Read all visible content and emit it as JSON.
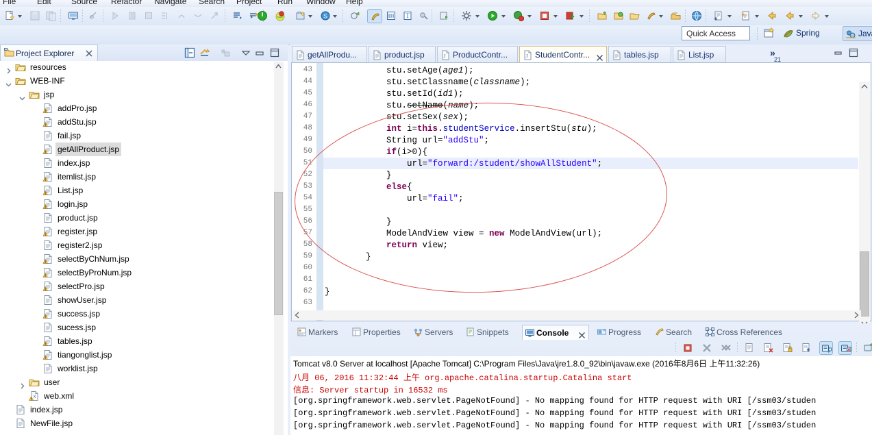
{
  "menu": {
    "items": [
      "File",
      "Edit",
      "Source",
      "Refactor",
      "Navigate",
      "Search",
      "Project",
      "Run",
      "Window",
      "Help"
    ]
  },
  "quick_access": {
    "placeholder": "Quick Access",
    "value": ""
  },
  "perspectives": [
    {
      "label": "Spring",
      "active": false
    },
    {
      "label": "Java EE",
      "active": true
    }
  ],
  "project_explorer": {
    "title": "Project Explorer",
    "tree": [
      {
        "label": "resources",
        "depth": 2,
        "type": "folder",
        "twisty": "collapsed",
        "selected": false
      },
      {
        "label": "WEB-INF",
        "depth": 2,
        "type": "folder",
        "twisty": "expanded",
        "selected": false
      },
      {
        "label": "jsp",
        "depth": 3,
        "type": "folder",
        "twisty": "expanded",
        "selected": false
      },
      {
        "label": "addPro.jsp",
        "depth": 4,
        "type": "jsp-warn",
        "twisty": "none",
        "selected": false
      },
      {
        "label": "addStu.jsp",
        "depth": 4,
        "type": "jsp-warn",
        "twisty": "none",
        "selected": false
      },
      {
        "label": "fail.jsp",
        "depth": 4,
        "type": "jsp",
        "twisty": "none",
        "selected": false
      },
      {
        "label": "getAllProduct.jsp",
        "depth": 4,
        "type": "jsp-warn",
        "twisty": "none",
        "selected": true
      },
      {
        "label": "index.jsp",
        "depth": 4,
        "type": "jsp",
        "twisty": "none",
        "selected": false
      },
      {
        "label": "itemlist.jsp",
        "depth": 4,
        "type": "jsp-warn",
        "twisty": "none",
        "selected": false
      },
      {
        "label": "List.jsp",
        "depth": 4,
        "type": "jsp-warn",
        "twisty": "none",
        "selected": false
      },
      {
        "label": "login.jsp",
        "depth": 4,
        "type": "jsp-warn",
        "twisty": "none",
        "selected": false
      },
      {
        "label": "product.jsp",
        "depth": 4,
        "type": "jsp",
        "twisty": "none",
        "selected": false
      },
      {
        "label": "register.jsp",
        "depth": 4,
        "type": "jsp-warn",
        "twisty": "none",
        "selected": false
      },
      {
        "label": "register2.jsp",
        "depth": 4,
        "type": "jsp",
        "twisty": "none",
        "selected": false
      },
      {
        "label": "selectByChNum.jsp",
        "depth": 4,
        "type": "jsp-warn",
        "twisty": "none",
        "selected": false
      },
      {
        "label": "selectByProNum.jsp",
        "depth": 4,
        "type": "jsp-warn",
        "twisty": "none",
        "selected": false
      },
      {
        "label": "selectPro.jsp",
        "depth": 4,
        "type": "jsp-warn",
        "twisty": "none",
        "selected": false
      },
      {
        "label": "showUser.jsp",
        "depth": 4,
        "type": "jsp",
        "twisty": "none",
        "selected": false
      },
      {
        "label": "success.jsp",
        "depth": 4,
        "type": "jsp-warn",
        "twisty": "none",
        "selected": false
      },
      {
        "label": "sucess.jsp",
        "depth": 4,
        "type": "jsp",
        "twisty": "none",
        "selected": false
      },
      {
        "label": "tables.jsp",
        "depth": 4,
        "type": "jsp-warn",
        "twisty": "none",
        "selected": false
      },
      {
        "label": "tiangonglist.jsp",
        "depth": 4,
        "type": "jsp-warn",
        "twisty": "none",
        "selected": false
      },
      {
        "label": "worklist.jsp",
        "depth": 4,
        "type": "jsp",
        "twisty": "none",
        "selected": false
      },
      {
        "label": "user",
        "depth": 3,
        "type": "folder",
        "twisty": "collapsed",
        "selected": false
      },
      {
        "label": "web.xml",
        "depth": 3,
        "type": "xml-warn",
        "twisty": "none",
        "selected": false
      },
      {
        "label": "index.jsp",
        "depth": 2,
        "type": "jsp",
        "twisty": "none",
        "selected": false
      },
      {
        "label": "NewFile.jsp",
        "depth": 2,
        "type": "jsp",
        "twisty": "none",
        "selected": false
      }
    ]
  },
  "editor": {
    "tabs": [
      {
        "label": "getAllProdu...",
        "type": "jsp",
        "active": false,
        "closable": false
      },
      {
        "label": "product.jsp",
        "type": "jsp",
        "active": false,
        "closable": false
      },
      {
        "label": "ProductContr...",
        "type": "java",
        "active": false,
        "closable": false
      },
      {
        "label": "StudentContr...",
        "type": "java",
        "active": true,
        "closable": true
      },
      {
        "label": "tables.jsp",
        "type": "jsp",
        "active": false,
        "closable": false
      },
      {
        "label": "List.jsp",
        "type": "jsp",
        "active": false,
        "closable": false
      }
    ],
    "overflow_count": "21",
    "overflow_symbol": "»",
    "first_line_number": 43,
    "highlighted_line": 51,
    "lines": [
      {
        "n": 43,
        "html": "            stu.setAge(<i class=\"ital\">age1</i>);"
      },
      {
        "n": 44,
        "html": "            stu.setClassname(<i class=\"ital\">classname</i>);"
      },
      {
        "n": 45,
        "html": "            stu.setId(<i class=\"ital\">id1</i>);"
      },
      {
        "n": 46,
        "html": "            stu.<span class=\"deprec\">setName</span>(<i class=\"ital\">name</i>);"
      },
      {
        "n": 47,
        "html": "            stu.setSex(<i class=\"ital\">sex</i>);"
      },
      {
        "n": 48,
        "html": "            <b class=\"kw\">int</b> i=<b class=\"kw\">this</b>.<span class=\"fld\">studentService</span>.insertStu(<i class=\"ital\">stu</i>);"
      },
      {
        "n": 49,
        "html": "            String url=<span class=\"str\">\"addStu\"</span>;"
      },
      {
        "n": 50,
        "html": "            <b class=\"kw\">if</b>(i&gt;0){"
      },
      {
        "n": 51,
        "html": "                url=<span class=\"str\">\"forward:/student/showAllStudent\"</span>;"
      },
      {
        "n": 52,
        "html": "            }"
      },
      {
        "n": 53,
        "html": "            <b class=\"kw\">else</b>{"
      },
      {
        "n": 54,
        "html": "                url=<span class=\"str\">\"fail\"</span>;"
      },
      {
        "n": 55,
        "html": ""
      },
      {
        "n": 56,
        "html": "            }"
      },
      {
        "n": 57,
        "html": "            ModelAndView view = <b class=\"kw\">new</b> ModelAndView(url);"
      },
      {
        "n": 58,
        "html": "            <b class=\"kw\">return</b> view;"
      },
      {
        "n": 59,
        "html": "        }"
      },
      {
        "n": 60,
        "html": ""
      },
      {
        "n": 61,
        "html": ""
      },
      {
        "n": 62,
        "html": "}"
      },
      {
        "n": 63,
        "html": ""
      }
    ],
    "annotation": {
      "shape": "ellipse",
      "color": "#d9534f"
    }
  },
  "console_panel": {
    "tabs": [
      {
        "label": "Markers",
        "active": false,
        "closable": false
      },
      {
        "label": "Properties",
        "active": false,
        "closable": false
      },
      {
        "label": "Servers",
        "active": false,
        "closable": false
      },
      {
        "label": "Snippets",
        "active": false,
        "closable": false
      },
      {
        "label": "Console",
        "active": true,
        "closable": true
      },
      {
        "label": "Progress",
        "active": false,
        "closable": false
      },
      {
        "label": "Search",
        "active": false,
        "closable": false
      },
      {
        "label": "Cross References",
        "active": false,
        "closable": false
      }
    ],
    "header": "Tomcat v8.0 Server at localhost [Apache Tomcat] C:\\Program Files\\Java\\jre1.8.0_92\\bin\\javaw.exe (2016年8月6日 上午11:32:26)",
    "lines": [
      {
        "text": "八月 06, 2016 11:32:44 上午 org.apache.catalina.startup.Catalina start",
        "color": "red"
      },
      {
        "text": "信息: Server startup in 16532 ms",
        "color": "red"
      },
      {
        "text": "[org.springframework.web.servlet.PageNotFound] - No mapping found for HTTP request with URI [/ssm03/studen",
        "color": "black"
      },
      {
        "text": "[org.springframework.web.servlet.PageNotFound] - No mapping found for HTTP request with URI [/ssm03/studen",
        "color": "black"
      },
      {
        "text": "[org.springframework.web.servlet.PageNotFound] - No mapping found for HTTP request with URI [/ssm03/studen",
        "color": "black"
      }
    ]
  },
  "colors": {
    "accent": "#cfe3f7",
    "annotation_red": "#d9534f",
    "console_red": "#cc0000",
    "string_blue": "#2a00ff",
    "keyword_purple": "#7f0055",
    "selection_gray": "#dcdcdc"
  }
}
